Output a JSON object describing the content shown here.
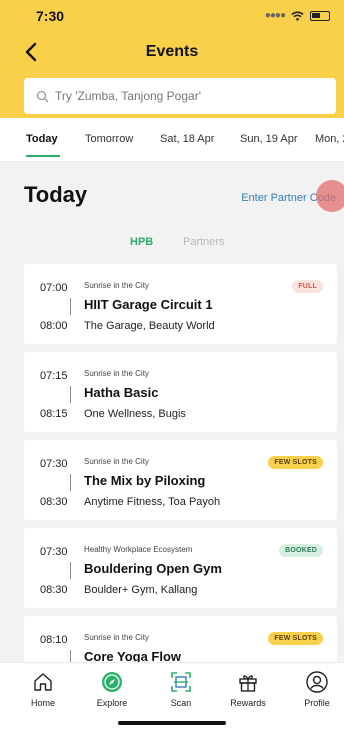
{
  "status_bar": {
    "time": "7:30"
  },
  "header": {
    "title": "Events"
  },
  "search": {
    "placeholder": "Try 'Zumba, Tanjong Pogar'"
  },
  "date_tabs": [
    "Today",
    "Tomorrow",
    "Sat, 18 Apr",
    "Sun, 19 Apr",
    "Mon, 2"
  ],
  "section": {
    "title": "Today",
    "partner_link": "Enter Partner Code"
  },
  "segments": [
    "HPB",
    "Partners"
  ],
  "events": [
    {
      "start": "07:00",
      "end": "08:00",
      "org": "Sunrise in the City",
      "name": "HIIT Garage Circuit 1",
      "venue": "The Garage, Beauty World",
      "badge": "FULL"
    },
    {
      "start": "07:15",
      "end": "08:15",
      "org": "Sunrise in the City",
      "name": "Hatha Basic",
      "venue": "One Wellness, Bugis",
      "badge": ""
    },
    {
      "start": "07:30",
      "end": "08:30",
      "org": "Sunrise in the City",
      "name": "The Mix by Piloxing",
      "venue": "Anytime Fitness, Toa Payoh",
      "badge": "FEW SLOTS"
    },
    {
      "start": "07:30",
      "end": "08:30",
      "org": "Healthy Workplace Ecosystem",
      "name": "Bouldering Open Gym",
      "venue": "Boulder+ Gym, Kallang",
      "badge": "BOOKED"
    },
    {
      "start": "08:10",
      "end": "",
      "org": "Sunrise in the City",
      "name": "Core Yoga Flow",
      "venue": "",
      "badge": "FEW SLOTS"
    }
  ],
  "bottom_nav": [
    {
      "label": "Home",
      "icon": "home-icon"
    },
    {
      "label": "Explore",
      "icon": "compass-icon"
    },
    {
      "label": "Scan",
      "icon": "scan-icon"
    },
    {
      "label": "Rewards",
      "icon": "gift-icon"
    },
    {
      "label": "Profile",
      "icon": "profile-icon"
    }
  ],
  "colors": {
    "header": "#f8d04a",
    "accent_green": "#2bb06b",
    "link_blue": "#2f7fb8",
    "background": "#f2f2f2"
  }
}
